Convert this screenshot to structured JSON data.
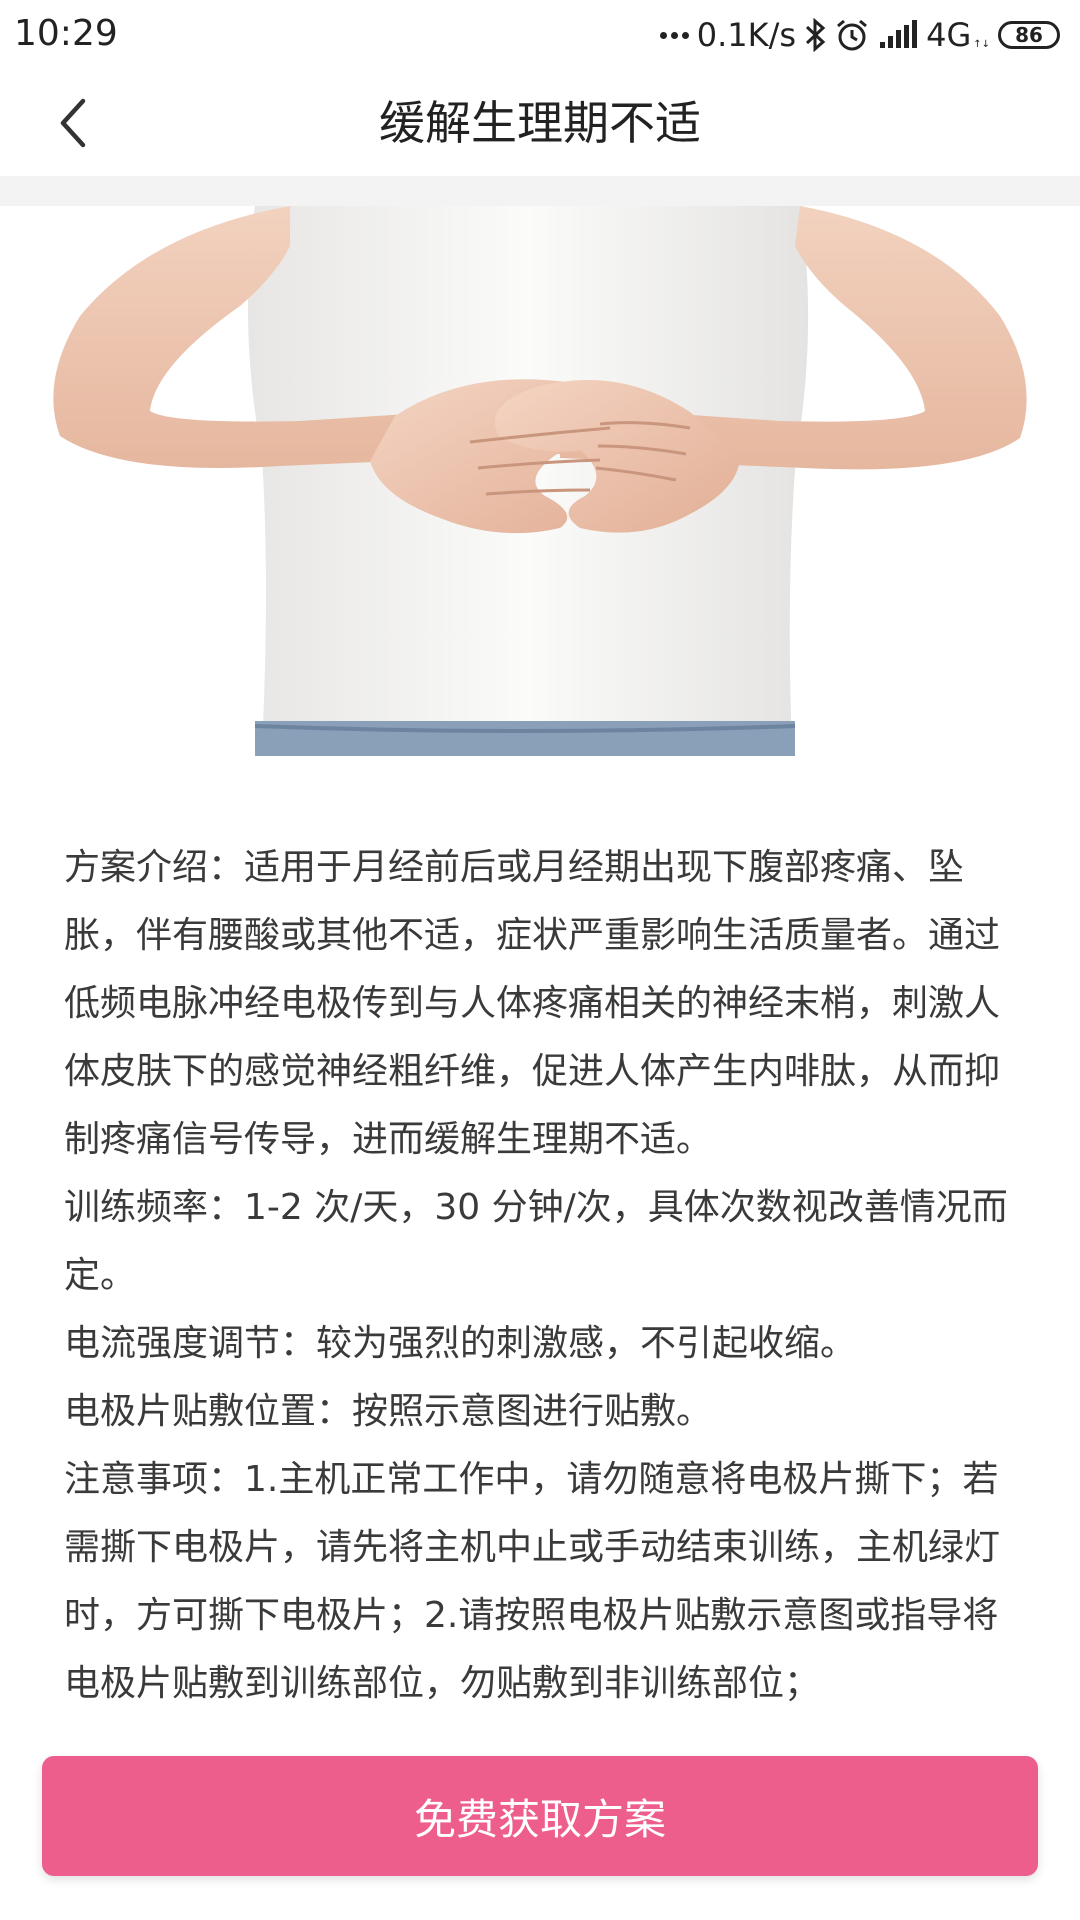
{
  "status_bar": {
    "time": "10:29",
    "net_speed": "0.1K/s",
    "network": "4G",
    "battery": "86"
  },
  "header": {
    "title": "缓解生理期不适"
  },
  "description": [
    "方案介绍：适用于月经前后或月经期出现下腹部疼痛、坠胀，伴有腰酸或其他不适，症状严重影响生活质量者。通过低频电脉冲经电极传到与人体疼痛相关的神经末梢，刺激人体皮肤下的感觉神经粗纤维，促进人体产生内啡肽，从而抑制疼痛信号传导，进而缓解生理期不适。",
    "训练频率：1-2 次/天，30 分钟/次，具体次数视改善情况而定。",
    "电流强度调节：较为强烈的刺激感，不引起收缩。",
    "电极片贴敷位置：按照示意图进行贴敷。",
    "注意事项：1.主机正常工作中，请勿随意将电极片撕下；若需撕下电极片，请先将主机中止或手动结束训练，主机绿灯时，方可撕下电极片；2.请按照电极片贴敷示意图或指导将电极片贴敷到训练部位，勿贴敷到非训练部位；"
  ],
  "cta": {
    "label": "免费获取方案"
  },
  "colors": {
    "accent": "#ee5e8c"
  }
}
